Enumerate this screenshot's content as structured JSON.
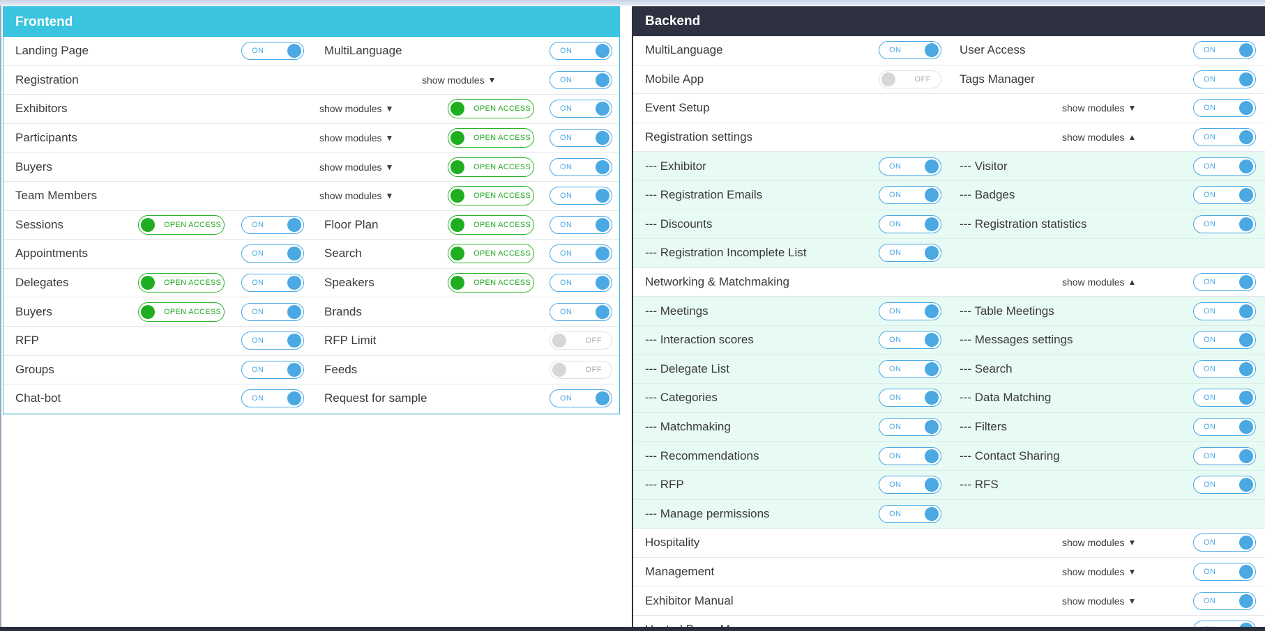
{
  "frontend": {
    "title": "Frontend",
    "rows": [
      {
        "a": {
          "label": "Landing Page",
          "toggle": "ON"
        },
        "b": {
          "label": "MultiLanguage",
          "toggle": "ON"
        }
      },
      {
        "a": {
          "label": "Registration"
        },
        "show": "show modules",
        "arrow": "▼",
        "toggle": "ON"
      },
      {
        "a": {
          "label": "Exhibitors"
        },
        "show": "show modules",
        "arrow": "▼",
        "open_access": "OPEN ACCESS",
        "toggle": "ON"
      },
      {
        "a": {
          "label": "Participants"
        },
        "show": "show modules",
        "arrow": "▼",
        "open_access": "OPEN ACCESS",
        "toggle": "ON"
      },
      {
        "a": {
          "label": "Buyers"
        },
        "show": "show modules",
        "arrow": "▼",
        "open_access": "OPEN ACCESS",
        "toggle": "ON"
      },
      {
        "a": {
          "label": "Team Members"
        },
        "show": "show modules",
        "arrow": "▼",
        "open_access": "OPEN ACCESS",
        "toggle": "ON"
      },
      {
        "a": {
          "label": "Sessions",
          "open_access": "OPEN ACCESS",
          "toggle": "ON"
        },
        "b": {
          "label": "Floor Plan",
          "open_access": "OPEN ACCESS",
          "toggle": "ON"
        }
      },
      {
        "a": {
          "label": "Appointments",
          "toggle": "ON"
        },
        "b": {
          "label": "Search",
          "open_access": "OPEN ACCESS",
          "toggle": "ON"
        }
      },
      {
        "a": {
          "label": "Delegates",
          "open_access": "OPEN ACCESS",
          "toggle": "ON"
        },
        "b": {
          "label": "Speakers",
          "open_access": "OPEN ACCESS",
          "toggle": "ON"
        }
      },
      {
        "a": {
          "label": "Buyers",
          "open_access": "OPEN ACCESS",
          "toggle": "ON"
        },
        "b": {
          "label": "Brands",
          "toggle": "ON"
        }
      },
      {
        "a": {
          "label": "RFP",
          "toggle": "ON"
        },
        "b": {
          "label": "RFP Limit",
          "toggle": "OFF"
        }
      },
      {
        "a": {
          "label": "Groups",
          "toggle": "ON"
        },
        "b": {
          "label": "Feeds",
          "toggle": "OFF"
        }
      },
      {
        "a": {
          "label": "Chat-bot",
          "toggle": "ON"
        },
        "b": {
          "label": "Request for sample",
          "toggle": "ON"
        }
      }
    ]
  },
  "backend": {
    "title": "Backend",
    "rows": [
      {
        "a": {
          "label": "MultiLanguage",
          "toggle": "ON"
        },
        "b": {
          "label": "User Access",
          "toggle": "ON"
        }
      },
      {
        "a": {
          "label": "Mobile App",
          "toggle": "OFF"
        },
        "b": {
          "label": "Tags Manager",
          "toggle": "ON"
        }
      },
      {
        "a": {
          "label": "Event Setup"
        },
        "show": "show modules",
        "arrow": "▼",
        "toggle": "ON"
      },
      {
        "a": {
          "label": "Registration settings"
        },
        "show": "show modules",
        "arrow": "▲",
        "toggle": "ON"
      },
      {
        "sub": true,
        "a": {
          "label": "--- Exhibitor",
          "toggle": "ON"
        },
        "b": {
          "label": "--- Visitor",
          "toggle": "ON"
        }
      },
      {
        "sub": true,
        "a": {
          "label": "--- Registration Emails",
          "toggle": "ON"
        },
        "b": {
          "label": "--- Badges",
          "toggle": "ON"
        }
      },
      {
        "sub": true,
        "a": {
          "label": "--- Discounts",
          "toggle": "ON"
        },
        "b": {
          "label": "--- Registration statistics",
          "toggle": "ON"
        }
      },
      {
        "sub": true,
        "a": {
          "label": "--- Registration Incomplete List",
          "toggle": "ON"
        }
      },
      {
        "a": {
          "label": "Networking & Matchmaking"
        },
        "show": "show modules",
        "arrow": "▲",
        "toggle": "ON"
      },
      {
        "sub": true,
        "a": {
          "label": "--- Meetings",
          "toggle": "ON"
        },
        "b": {
          "label": "--- Table Meetings",
          "toggle": "ON"
        }
      },
      {
        "sub": true,
        "a": {
          "label": "--- Interaction scores",
          "toggle": "ON"
        },
        "b": {
          "label": "--- Messages settings",
          "toggle": "ON"
        }
      },
      {
        "sub": true,
        "a": {
          "label": "--- Delegate List",
          "toggle": "ON"
        },
        "b": {
          "label": "--- Search",
          "toggle": "ON"
        }
      },
      {
        "sub": true,
        "a": {
          "label": "--- Categories",
          "toggle": "ON"
        },
        "b": {
          "label": "--- Data Matching",
          "toggle": "ON"
        }
      },
      {
        "sub": true,
        "a": {
          "label": "--- Matchmaking",
          "toggle": "ON"
        },
        "b": {
          "label": "--- Filters",
          "toggle": "ON"
        }
      },
      {
        "sub": true,
        "a": {
          "label": "--- Recommendations",
          "toggle": "ON"
        },
        "b": {
          "label": "--- Contact Sharing",
          "toggle": "ON"
        }
      },
      {
        "sub": true,
        "a": {
          "label": "--- RFP",
          "toggle": "ON"
        },
        "b": {
          "label": "--- RFS",
          "toggle": "ON"
        }
      },
      {
        "sub": true,
        "a": {
          "label": "--- Manage permissions",
          "toggle": "ON"
        }
      },
      {
        "a": {
          "label": "Hospitality"
        },
        "show": "show modules",
        "arrow": "▼",
        "toggle": "ON"
      },
      {
        "a": {
          "label": "Management"
        },
        "show": "show modules",
        "arrow": "▼",
        "toggle": "ON"
      },
      {
        "a": {
          "label": "Exhibitor Manual"
        },
        "show": "show modules",
        "arrow": "▼",
        "toggle": "ON"
      },
      {
        "a": {
          "label": "Hosted Buyer M..."
        },
        "toggle": "ON"
      }
    ]
  },
  "colors": {
    "frontend_header": "#3ac4df",
    "backend_header": "#2e3140",
    "toggle_on": "#4aa8e2",
    "open_access": "#1fae1f",
    "sub_row_bg": "#e7faf3"
  }
}
